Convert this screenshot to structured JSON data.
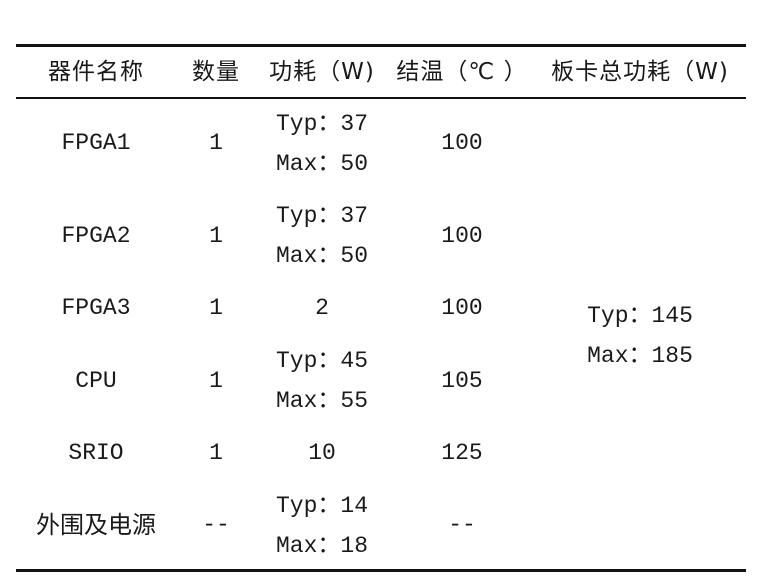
{
  "table": {
    "headers": [
      "器件名称",
      "数量",
      "功耗（W)",
      "结温（℃ ）",
      "板卡总功耗（W)"
    ],
    "rows": [
      {
        "name": "FPGA1",
        "qty": "1",
        "power": {
          "typ": "Typ：37",
          "max": "Max：50"
        },
        "tj": "100"
      },
      {
        "name": "FPGA2",
        "qty": "1",
        "power": {
          "typ": "Typ：37",
          "max": "Max：50"
        },
        "tj": "100"
      },
      {
        "name": "FPGA3",
        "qty": "1",
        "power_single": "2",
        "tj": "100"
      },
      {
        "name": "CPU",
        "qty": "1",
        "power": {
          "typ": "Typ：45",
          "max": "Max：55"
        },
        "tj": "105"
      },
      {
        "name": "SRIO",
        "qty": "1",
        "power_single": "10",
        "tj": "125"
      },
      {
        "name": "外围及电源",
        "qty": "--",
        "power": {
          "typ": "Typ：14",
          "max": "Max：18"
        },
        "tj": "--"
      }
    ],
    "board_total": {
      "typ": "Typ：145",
      "max": "Max：185"
    }
  }
}
